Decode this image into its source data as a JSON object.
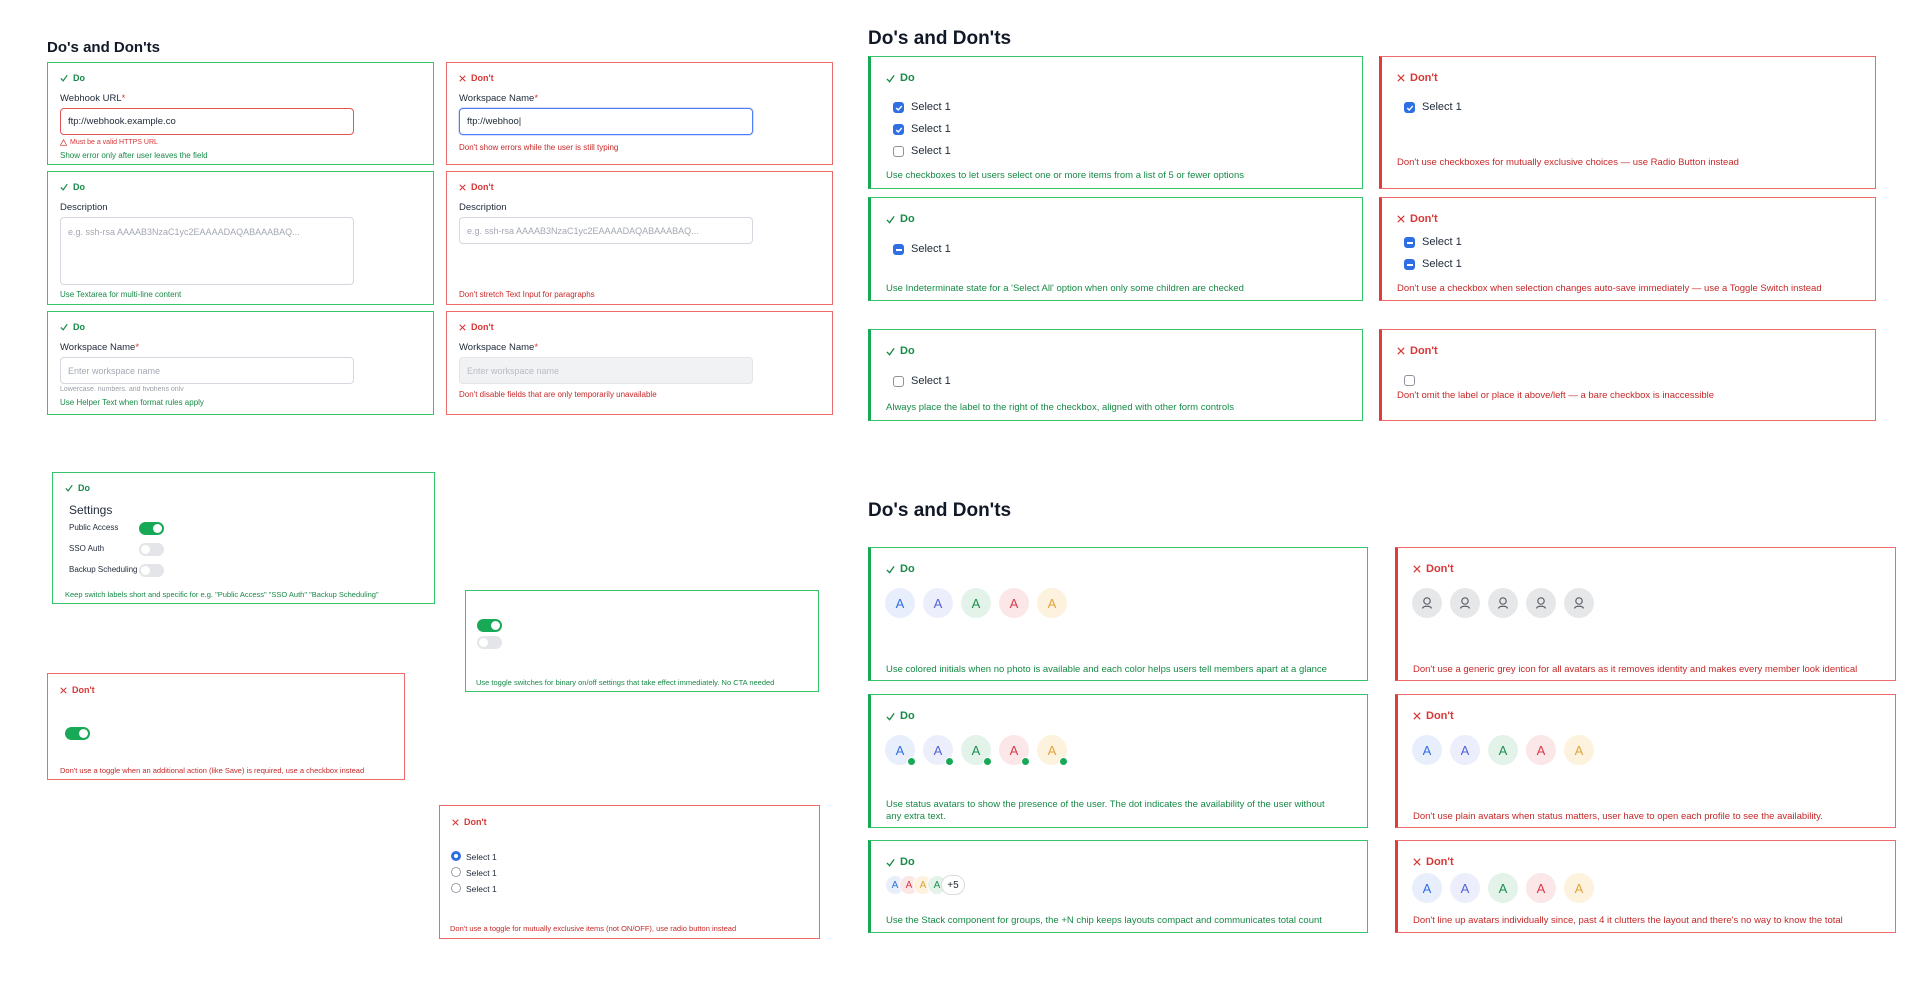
{
  "sections": {
    "text_input_title": "Do's and Don'ts",
    "checkbox_title": "Do's and Don'ts",
    "avatar_title": "Do's and Don'ts"
  },
  "labels": {
    "do": "Do",
    "dont": "Don't"
  },
  "text_input": {
    "c1": {
      "label": "Webhook URL",
      "req": "*",
      "value": "ftp://webhook.example.co",
      "error": "Must be a valid HTTPS URL",
      "caption": "Show error only after user leaves the field"
    },
    "c2": {
      "label": "Workspace Name",
      "req": "*",
      "value": "ftp://webhoo|",
      "caption": "Don't show errors while the user is still typing"
    },
    "c3": {
      "label": "Description",
      "placeholder": "e.g. ssh-rsa AAAAB3NzaC1yc2EAAAADAQABAAABAQ...",
      "caption": "Use Textarea for multi-line content"
    },
    "c4": {
      "label": "Description",
      "placeholder": "e.g. ssh-rsa AAAAB3NzaC1yc2EAAAADAQABAAABAQ...",
      "caption": "Don't stretch Text Input for paragraphs"
    },
    "c5": {
      "label": "Workspace Name",
      "req": "*",
      "placeholder": "Enter workspace name",
      "helper": "Lowercase, numbers, and hyphens only",
      "caption": "Use Helper Text when format rules apply"
    },
    "c6": {
      "label": "Workspace Name",
      "req": "*",
      "placeholder": "Enter workspace name",
      "caption": "Don't disable fields that are only temporarily unavailable"
    }
  },
  "toggle": {
    "c1": {
      "title": "Settings",
      "items": [
        {
          "label": "Public Access",
          "on": true
        },
        {
          "label": "SSO Auth",
          "on": false
        },
        {
          "label": "Backup Scheduling",
          "on": false
        }
      ],
      "caption": "Keep switch labels short and specific for e.g. \"Public Access\" \"SSO Auth\" \"Backup Scheduling\""
    },
    "c2": {
      "caption": "Use toggle switches for binary on/off settings that take effect immediately. No CTA needed"
    },
    "c3": {
      "caption": "Don't use a toggle when an additional action (like Save) is required, use a checkbox instead"
    },
    "c4": {
      "options": [
        "Select 1",
        "Select 1",
        "Select 1"
      ],
      "caption": "Don't use a toggle for mutually exclusive items (not ON/OFF), use radio button instead"
    }
  },
  "checkbox": {
    "c1": {
      "options": [
        "Select 1",
        "Select 1",
        "Select 1"
      ],
      "caption": "Use checkboxes to let users select one or more items from a list of 5 or fewer options"
    },
    "c2": {
      "options": [
        "Select 1"
      ],
      "caption": "Don't use checkboxes for mutually exclusive choices — use Radio Button instead"
    },
    "c3": {
      "options": [
        "Select 1"
      ],
      "caption": "Use Indeterminate state for a 'Select All' option when only some children are checked"
    },
    "c4": {
      "options": [
        "Select 1",
        "Select 1"
      ],
      "caption": "Don't use a checkbox when selection changes auto-save immediately — use a Toggle Switch instead"
    },
    "c5": {
      "options": [
        "Select 1"
      ],
      "caption": "Always place the label to the right of the checkbox, aligned with other form controls"
    },
    "c6": {
      "caption": "Don't omit the label or place it above/left — a bare checkbox is inaccessible"
    }
  },
  "avatar": {
    "initial": "A",
    "plus": "+5",
    "c1": {
      "caption": "Use colored initials when no photo is available and each color helps users tell members apart at a glance"
    },
    "c2": {
      "caption": "Don't use a generic grey icon for all avatars as it removes identity and makes every member look identical"
    },
    "c3": {
      "caption_l1": "Use status avatars to show the presence of the user. The dot indicates the availability of the user without",
      "caption_l2": "any extra text."
    },
    "c4": {
      "caption": "Don't use plain avatars when status matters, user have to open each profile to see the availability."
    },
    "c5": {
      "caption": "Use the Stack component for groups, the +N chip keeps layouts compact and communicates total count"
    },
    "c6": {
      "caption": "Don't line up avatars individually since, past 4 it clutters the layout and there's no way to know the total"
    }
  },
  "colors": {
    "do": "#18a957",
    "dont": "#e23b3b",
    "primary": "#2f6fe4"
  },
  "icons": {
    "do": "check-icon",
    "dont": "x-icon",
    "avatar_placeholder": "user-icon"
  }
}
